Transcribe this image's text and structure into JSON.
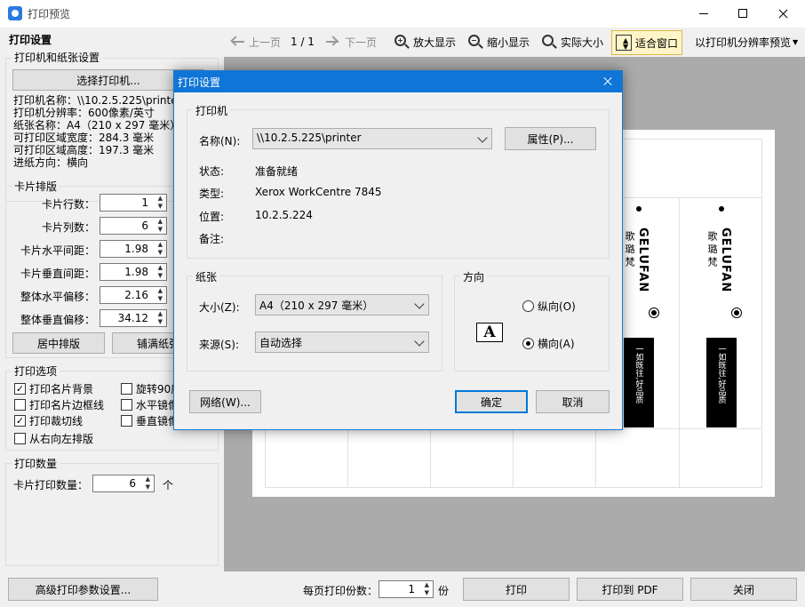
{
  "window": {
    "title": "打印预览"
  },
  "left": {
    "panel_title": "打印设置",
    "printer_group": {
      "title": "打印机和纸张设置",
      "select_button": "选择打印机...",
      "info": [
        "打印机名称：\\\\10.2.5.225\\printe",
        "打印机分辨率：600像素/英寸",
        "纸张名称：A4（210 x 297 毫米）",
        "可打印区域宽度：284.3 毫米",
        "可打印区域高度：197.3 毫米",
        "进纸方向：横向"
      ]
    },
    "layout_group": {
      "title": "卡片排版",
      "rows": [
        {
          "label": "卡片行数：",
          "value": "1"
        },
        {
          "label": "卡片列数：",
          "value": "6"
        },
        {
          "label": "卡片水平间距：",
          "value": "1.98"
        },
        {
          "label": "卡片垂直间距：",
          "value": "1.98"
        },
        {
          "label": "整体水平偏移：",
          "value": "2.16"
        },
        {
          "label": "整体垂直偏移：",
          "value": "34.12"
        }
      ],
      "center_button": "居中排版",
      "fill_button": "铺满纸张"
    },
    "print_options": {
      "title": "打印选项",
      "items": [
        {
          "label": "打印名片背景",
          "checked": true
        },
        {
          "label": "旋转90度",
          "checked": false
        },
        {
          "label": "打印名片边框线",
          "checked": false
        },
        {
          "label": "水平镜像",
          "checked": false
        },
        {
          "label": "打印裁切线",
          "checked": true
        },
        {
          "label": "垂直镜像",
          "checked": false
        },
        {
          "label": "从右向左排版",
          "checked": false
        }
      ]
    },
    "print_count": {
      "title": "打印数量",
      "label": "卡片打印数量：",
      "value": "6",
      "unit": "个"
    }
  },
  "toolbar": {
    "prev": "上一页",
    "page": "1 / 1",
    "next": "下一页",
    "zoom_in": "放大显示",
    "zoom_out": "缩小显示",
    "actual": "实际大小",
    "fit": "适合窗口",
    "resolution": "以打印机分辨率预览"
  },
  "preview": {
    "brand": "GELUFAN",
    "sub": "歌 璐 梵",
    "slogan": "一如既往,好品质"
  },
  "dialog": {
    "title": "打印设置",
    "printer_section": "打印机",
    "name_label": "名称(N):",
    "name_value": "\\\\10.2.5.225\\printer",
    "properties_button": "属性(P)...",
    "status_label": "状态:",
    "status_value": "准备就绪",
    "type_label": "类型:",
    "type_value": "Xerox WorkCentre 7845",
    "location_label": "位置:",
    "location_value": "10.2.5.224",
    "comment_label": "备注:",
    "paper_section": "纸张",
    "size_label": "大小(Z):",
    "size_value": "A4（210 x 297 毫米）",
    "source_label": "来源(S):",
    "source_value": "自动选择",
    "orientation_section": "方向",
    "portrait": "纵向(O)",
    "landscape": "横向(A)",
    "orientation_selected": "landscape",
    "network_button": "网络(W)...",
    "ok_button": "确定",
    "cancel_button": "取消"
  },
  "bottom": {
    "advanced_button": "高级打印参数设置...",
    "copies_label": "每页打印份数：",
    "copies_value": "1",
    "copies_unit": "份",
    "print_button": "打印",
    "pdf_button": "打印到 PDF",
    "close_button": "关闭"
  }
}
